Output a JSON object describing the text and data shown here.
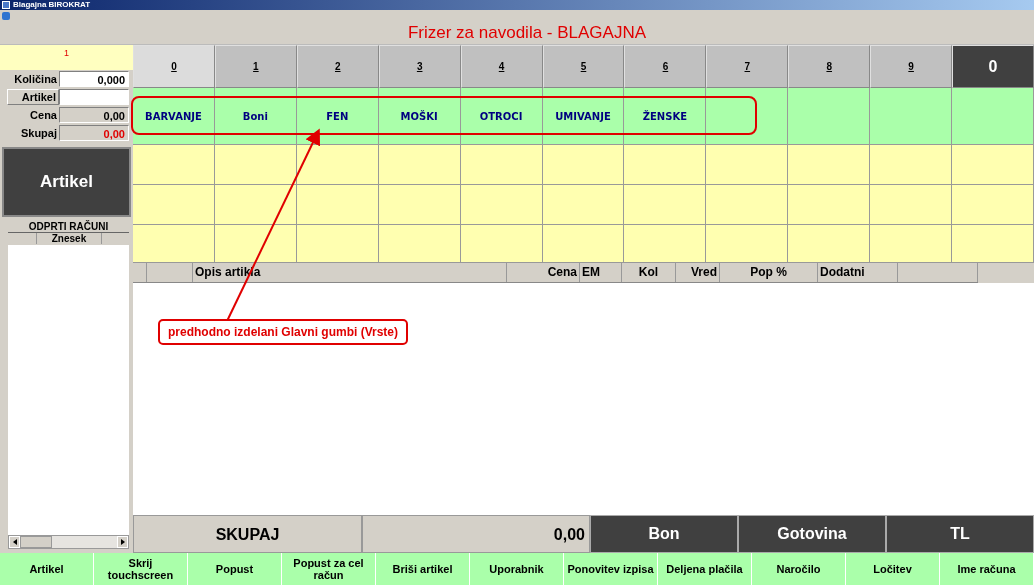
{
  "window": {
    "title": "Blagajna BIROKRAT"
  },
  "header": {
    "title": "Frizer za navodila - BLAGAJNA"
  },
  "left_panel": {
    "counter": "1",
    "fields": [
      {
        "label": "Količina",
        "value": "0,000",
        "kind": "input"
      },
      {
        "label": "Artikel",
        "kind": "button"
      },
      {
        "label": "Cena",
        "value": "0,00",
        "kind": "readonly"
      },
      {
        "label": "Skupaj",
        "value": "0,00",
        "kind": "total"
      }
    ],
    "artikel_button": "Artikel",
    "open_bills": {
      "title": "ODPRTI RAČUNI",
      "column": "Znesek"
    }
  },
  "number_keys": [
    {
      "label": "0",
      "selected": true
    },
    {
      "label": "1",
      "selected": false
    },
    {
      "label": "2",
      "selected": false
    },
    {
      "label": "3",
      "selected": false
    },
    {
      "label": "4",
      "selected": false
    },
    {
      "label": "5",
      "selected": false
    },
    {
      "label": "6",
      "selected": false
    },
    {
      "label": "7",
      "selected": false
    },
    {
      "label": "8",
      "selected": false
    },
    {
      "label": "9",
      "selected": false
    }
  ],
  "zero_key": "0",
  "groups": [
    "BARVANJE",
    "Boni",
    "FEN",
    "MOŠKI",
    "OTROCI",
    "UMIVANJE",
    "ŽENSKE"
  ],
  "table": {
    "columns": [
      "Opis artikla",
      "Cena",
      "EM",
      "Kol",
      "Vred",
      "Pop %",
      "Dodatni"
    ]
  },
  "totals": {
    "label": "SKUPAJ",
    "value": "0,00",
    "payments": [
      "Bon",
      "Gotovina",
      "TL"
    ]
  },
  "buttons": [
    "Artikel",
    "Skrij touchscreen",
    "Popust",
    "Popust za cel račun",
    "Briši artikel",
    "Uporabnik",
    "Ponovitev izpisa",
    "Deljena plačila",
    "Naročilo",
    "Ločitev",
    "Ime računa"
  ],
  "annotation": {
    "text": "predhodno izdelani Glavni gumbi (Vrste)"
  }
}
